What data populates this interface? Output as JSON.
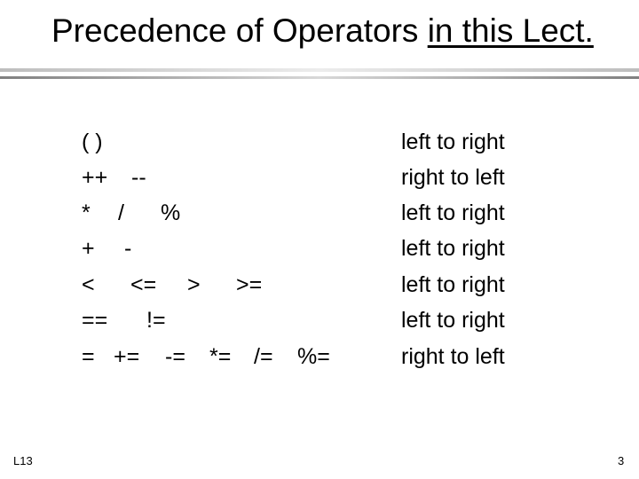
{
  "slide": {
    "title": {
      "plain": "Precedence of Operators ",
      "underlined": "in this Lect."
    },
    "rows": [
      {
        "operators": [
          "( )"
        ],
        "associativity": "left to right"
      },
      {
        "operators": [
          "++",
          "--"
        ],
        "associativity": "right to left"
      },
      {
        "operators": [
          "*",
          "/",
          "%"
        ],
        "associativity": "left to right"
      },
      {
        "operators": [
          "+",
          "-"
        ],
        "associativity": "left to right"
      },
      {
        "operators": [
          "<",
          "<=",
          ">",
          ">="
        ],
        "associativity": "left to right"
      },
      {
        "operators": [
          "==",
          "!="
        ],
        "associativity": "left to right"
      },
      {
        "operators": [
          "=",
          "+=",
          "-=",
          "*=",
          "/=",
          "%="
        ],
        "associativity": "right to left"
      }
    ],
    "footer": {
      "lecture": "L13",
      "page_number": "3"
    }
  }
}
